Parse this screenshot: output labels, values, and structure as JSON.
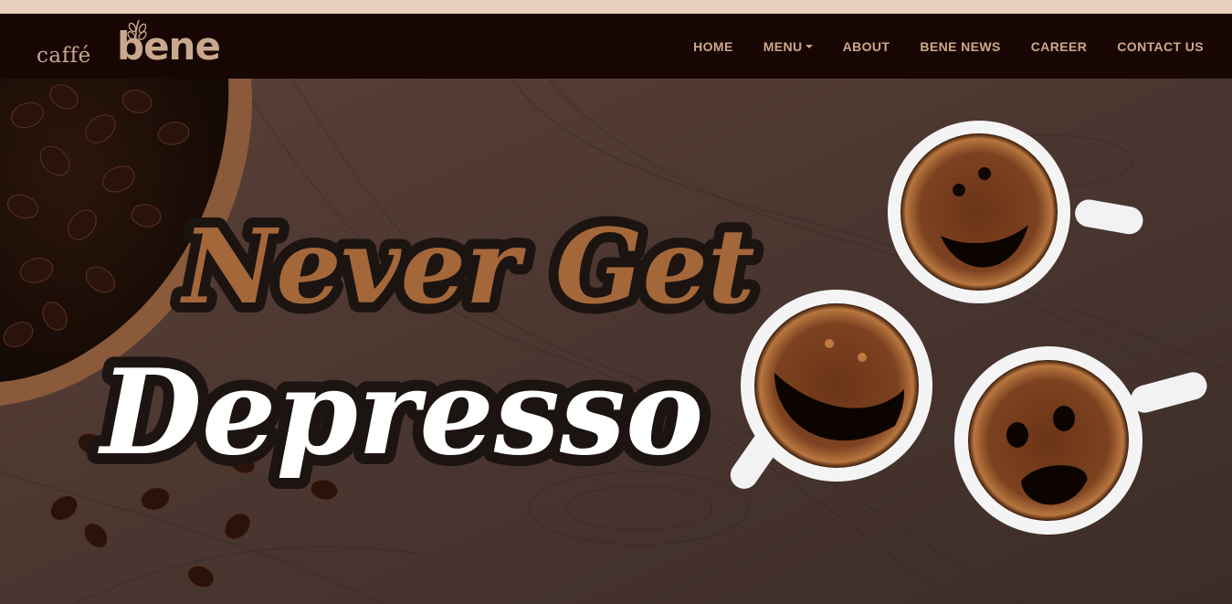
{
  "brand": {
    "logo_prefix": "caffé",
    "logo_name": "bene"
  },
  "nav": {
    "items": [
      {
        "label": "HOME",
        "has_dropdown": false
      },
      {
        "label": "MENU",
        "has_dropdown": true
      },
      {
        "label": "ABOUT",
        "has_dropdown": false
      },
      {
        "label": "BENE NEWS",
        "has_dropdown": false
      },
      {
        "label": "CAREER",
        "has_dropdown": false
      },
      {
        "label": "CONTACT US",
        "has_dropdown": false
      }
    ]
  },
  "hero": {
    "headline_line1": "Never Get",
    "headline_line2": "Depresso"
  },
  "colors": {
    "navbar_bg": "#170604",
    "nav_text": "#cfa88a",
    "top_strip": "#e8cfbd",
    "headline_brown": "#a4673a",
    "headline_white": "#ffffff",
    "wood": "#4a3630"
  }
}
